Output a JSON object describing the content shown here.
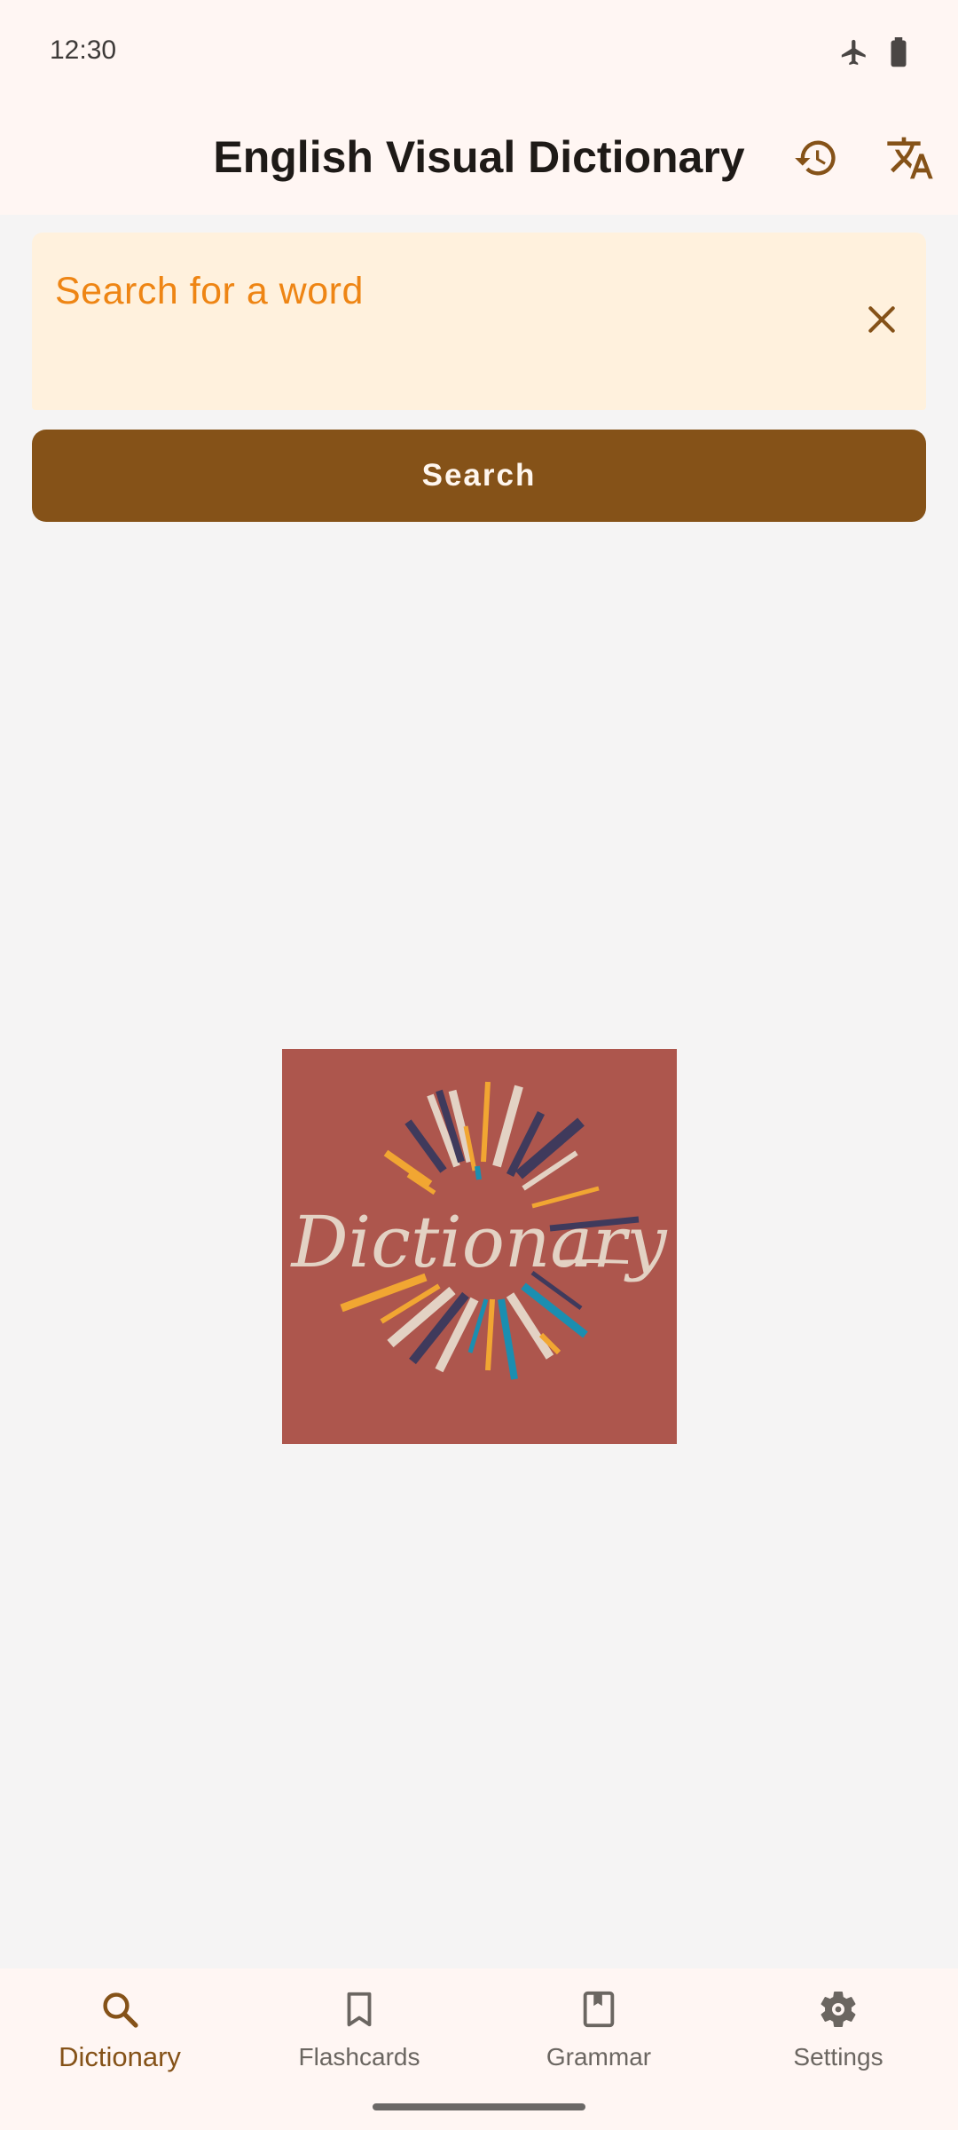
{
  "status_bar": {
    "time": "12:30",
    "icons": [
      "airplane-icon",
      "battery-icon"
    ]
  },
  "app_bar": {
    "title": "English Visual Dictionary",
    "actions": [
      "history-icon",
      "translate-icon"
    ]
  },
  "search": {
    "placeholder": "Search for a word",
    "value": "",
    "button_label": "Search"
  },
  "logo": {
    "text": "Dictionary"
  },
  "bottom_nav": {
    "items": [
      {
        "label": "Dictionary",
        "icon": "search-icon",
        "active": true
      },
      {
        "label": "Flashcards",
        "icon": "bookmark-icon",
        "active": false
      },
      {
        "label": "Grammar",
        "icon": "book-icon",
        "active": false
      },
      {
        "label": "Settings",
        "icon": "gear-icon",
        "active": false
      }
    ]
  },
  "colors": {
    "accent": "#855218",
    "placeholder": "#ee8514",
    "search_bg": "#fff1dd",
    "logo_bg": "#ad564d"
  }
}
